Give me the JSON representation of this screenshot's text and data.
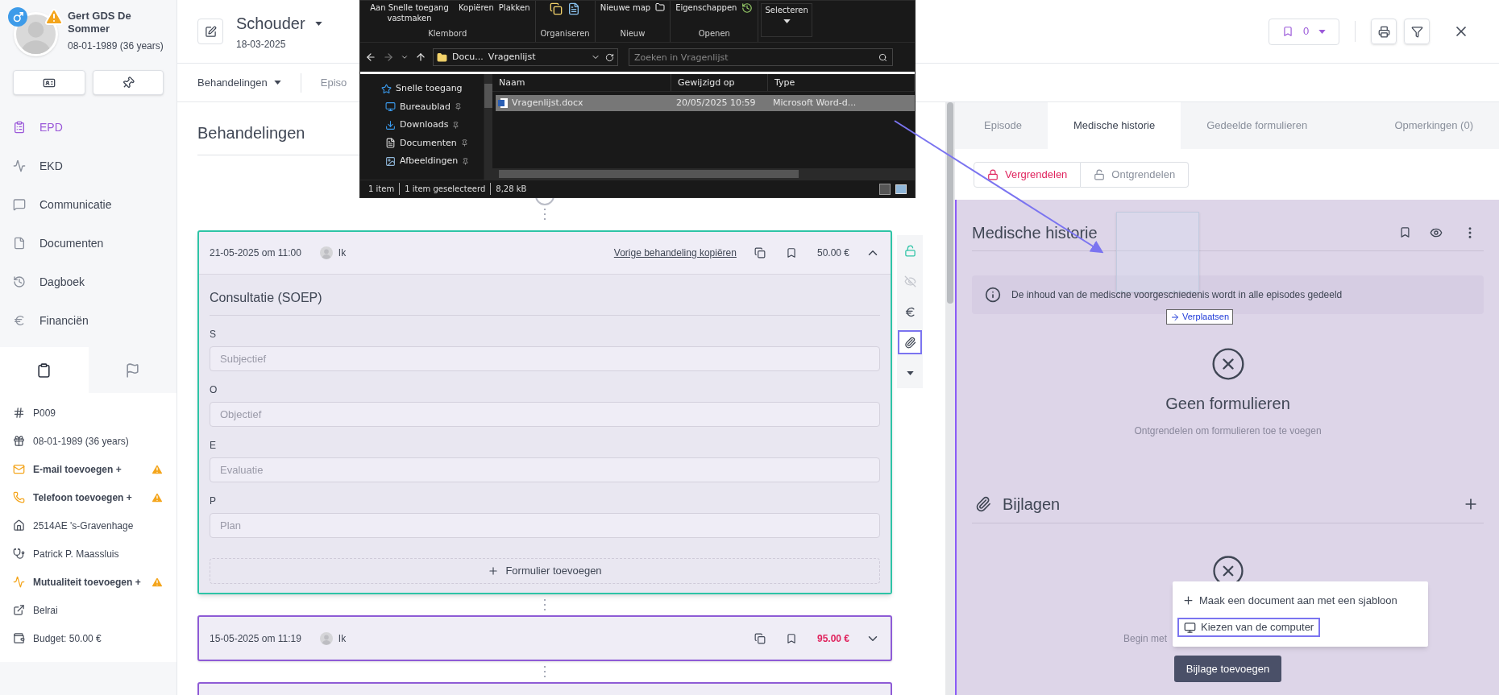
{
  "patient": {
    "name": "Gert GDS De Sommer",
    "birth": "08-01-1989 (36 years)",
    "warning": true
  },
  "sidebar": {
    "nav": [
      {
        "label": "EPD",
        "selected": true
      },
      {
        "label": "EKD",
        "selected": false
      },
      {
        "label": "Communicatie",
        "selected": false
      },
      {
        "label": "Documenten",
        "selected": false
      },
      {
        "label": "Dagboek",
        "selected": false
      },
      {
        "label": "Financiën",
        "selected": false
      }
    ],
    "tabs": [
      {
        "selected": true
      },
      {
        "selected": false
      }
    ],
    "info": [
      {
        "text": "P009",
        "warning": false
      },
      {
        "text": "08-01-1989 (36 years)",
        "warning": false
      },
      {
        "text": "E-mail toevoegen +",
        "warning": true
      },
      {
        "text": "Telefoon toevoegen +",
        "warning": true
      },
      {
        "text": "2514AE 's-Gravenhage",
        "warning": false
      },
      {
        "text": "Patrick P. Maassluis",
        "warning": false
      },
      {
        "text": "Mutualiteit toevoegen +",
        "warning": true
      },
      {
        "text": "Belrai",
        "warning": false
      },
      {
        "text": "Budget: 50.00 €",
        "warning": false
      }
    ]
  },
  "header": {
    "title": "Schouder",
    "date": "18-03-2025",
    "bookmark_count": "0"
  },
  "subnav": {
    "items": [
      "Behandelingen",
      "Episo"
    ]
  },
  "treatments": {
    "title": "Behandelingen",
    "items": [
      {
        "date": "21-05-2025 om 11:00",
        "user": "Ik",
        "copy_link": "Vorige behandeling kopiëren",
        "price": "50.00 €",
        "price_alert": false,
        "expanded": true,
        "selected": true
      },
      {
        "date": "15-05-2025 om 11:19",
        "user": "Ik",
        "price": "95.00 €",
        "price_alert": true,
        "expanded": false,
        "selected": false
      }
    ],
    "form": {
      "title": "Consultatie (SOEP)",
      "fields": [
        {
          "label": "S",
          "placeholder": "Subjectief"
        },
        {
          "label": "O",
          "placeholder": "Objectief"
        },
        {
          "label": "E",
          "placeholder": "Evaluatie"
        },
        {
          "label": "P",
          "placeholder": "Plan"
        }
      ],
      "add_button": "Formulier toevoegen"
    },
    "actions": [
      {
        "selected": false,
        "disabled": false
      },
      {
        "selected": false,
        "disabled": true
      },
      {
        "selected": false,
        "disabled": false
      },
      {
        "selected": true,
        "disabled": false
      },
      {
        "selected": false,
        "disabled": false
      }
    ]
  },
  "explorer": {
    "ribbon": [
      {
        "label": "Klembord",
        "items": [
          "Aan Snelle toegang vastmaken",
          "Kopiëren",
          "Plakken"
        ]
      },
      {
        "label": "Organiseren"
      },
      {
        "label": "Nieuw",
        "items": [
          "Nieuwe map"
        ]
      },
      {
        "label": "Openen",
        "items": [
          "Eigenschappen"
        ]
      }
    ],
    "select_button": "Selecteren",
    "path": [
      "Docu...",
      "Vragenlijst"
    ],
    "search": {
      "placeholder": "Zoeken in Vragenlijst"
    },
    "nav": [
      {
        "label": "Snelle toegang",
        "pinned": false
      },
      {
        "label": "Bureaublad",
        "pinned": true
      },
      {
        "label": "Downloads",
        "pinned": true
      },
      {
        "label": "Documenten",
        "pinned": true
      },
      {
        "label": "Afbeeldingen",
        "pinned": true
      }
    ],
    "columns": [
      "Naam",
      "Gewijzigd op",
      "Type"
    ],
    "files": [
      {
        "name": "Vragenlijst.docx",
        "modified": "20/05/2025 10:59",
        "type": "Microsoft Word-d...",
        "selected": true
      }
    ],
    "status": [
      "1 item",
      "1 item geselecteerd",
      "8,28 kB"
    ]
  },
  "drag": {
    "label": "Verplaatsen"
  },
  "right_panel": {
    "tabs": [
      {
        "label": "Episode",
        "selected": false
      },
      {
        "label": "Medische historie",
        "selected": true
      },
      {
        "label": "Gedeelde formulieren",
        "selected": false
      },
      {
        "label": "Opmerkingen (0)",
        "selected": false
      }
    ],
    "lock_buttons": [
      {
        "label": "Vergrendelen",
        "selected": true
      },
      {
        "label": "Ontgrendelen",
        "selected": false
      }
    ],
    "section_title": "Medische historie",
    "info": "De inhoud van de medische voorgeschiedenis wordt in alle episodes gedeeld",
    "empty_forms": {
      "title": "Geen formulieren",
      "subtitle": "Ontgrendelen om formulieren toe te voegen"
    },
    "attachments": {
      "title": "Bijlagen",
      "empty_text": "Begin met",
      "button": "Bijlage toevoegen"
    },
    "menu": [
      {
        "label": "Maak een document aan met een sjabloon",
        "selected": false
      },
      {
        "label": "Kiezen van de computer",
        "selected": true
      }
    ]
  }
}
